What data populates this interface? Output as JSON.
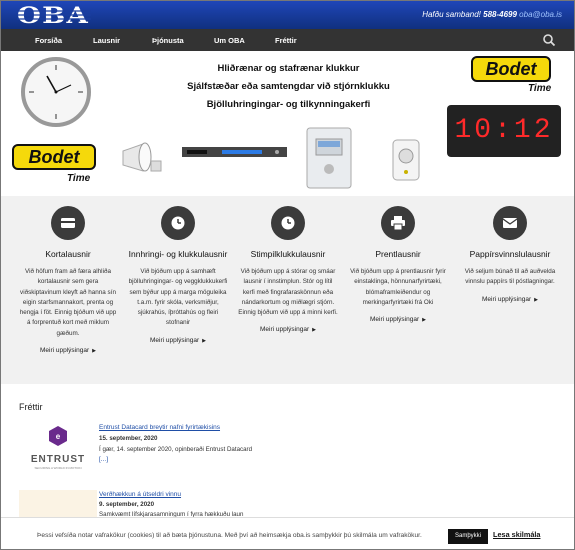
{
  "header": {
    "logo_text": "OBA",
    "contact_label": "Hafðu samband!",
    "phone": "588-4699",
    "email": "oba@oba.is"
  },
  "nav": {
    "items": [
      "Forsíða",
      "Lausnir",
      "Þjónusta",
      "Um OBA",
      "Fréttir"
    ]
  },
  "hero": {
    "line1": "Hliðrænar og stafrænar klukkur",
    "line2": "Sjálfstæðar eða samtengdar við stjórnklukku",
    "line3": "Bjölluhringingar- og tilkynningakerfi",
    "brand": "Bodet",
    "brand_sub": "Time",
    "digital_display": "10:12"
  },
  "solutions": [
    {
      "icon": "card-icon",
      "title": "Kortalausnir",
      "text": "Við höfum fram að færa alhliða kortalausnir sem gera viðskiptavinum kleyft að hanna sín eigin starfsmannakort, prenta og hengja í föt. Einnig bjóðum við upp á forprentuð kort með miklum gæðum.",
      "more": "Meiri upplýsingar"
    },
    {
      "icon": "clock-icon",
      "title": "Innhringi- og klukkulausnir",
      "text": "Við bjóðum upp á samhæft bjölluhringingar- og veggklukkukerfi sem býður upp á marga möguleika t.a.m. fyrir skóla, verksmiðjur, sjúkrahús, íþróttahús og fleiri stofnanir",
      "more": "Meiri upplýsingar"
    },
    {
      "icon": "clock-icon",
      "title": "Stimpilklukkulausnir",
      "text": "Við bjóðum upp á stórar og smáar lausnir í innstimplun. Stór og lítil kerfi með fingrafaraskönnun eða nándarkortum og miðlægri stjórn. Einnig bjóðum við upp á minni kerfi.",
      "more": "Meiri upplýsingar"
    },
    {
      "icon": "printer-icon",
      "title": "Prentlausnir",
      "text": "Við bjóðum upp á prentlausnir fyrir einstaklinga, hönnunarfyrirtæki, blómaframleiðendur og merkingarfyrirtæki frá Oki",
      "more": "Meiri upplýsingar"
    },
    {
      "icon": "envelope-icon",
      "title": "Pappírsvinnslulausnir",
      "text": "Við seljum búnað til að auðvelda vinnslu pappírs til póstlagningar.",
      "more": "Meiri upplýsingar"
    }
  ],
  "news": {
    "heading": "Fréttir",
    "items": [
      {
        "title": "Entrust Datacard breytir nafni fyrirtækisins",
        "date": "15. september, 2020",
        "text": "Í gær, 14. september 2020, opinberaði Entrust Datacard",
        "more": "[...]",
        "logo_text": "ENTRUST",
        "logo_tagline": "SECURING A WORLD IN MOTION"
      },
      {
        "title": "Verðhækkun á útseldri vinnu",
        "date": "9. september, 2020",
        "text": "Samkvæmt lífskjarasamningum í fyrra hækkuðu laun"
      }
    ]
  },
  "cookie": {
    "text": "Þessi vefsíða notar vafrakökur (cookies) til að bæta þjónustuna. Með því að heimsækja oba.is samþykkir þú skilmála um vafrakökur.",
    "accept": "Samþykki",
    "read": "Lesa skilmála"
  }
}
